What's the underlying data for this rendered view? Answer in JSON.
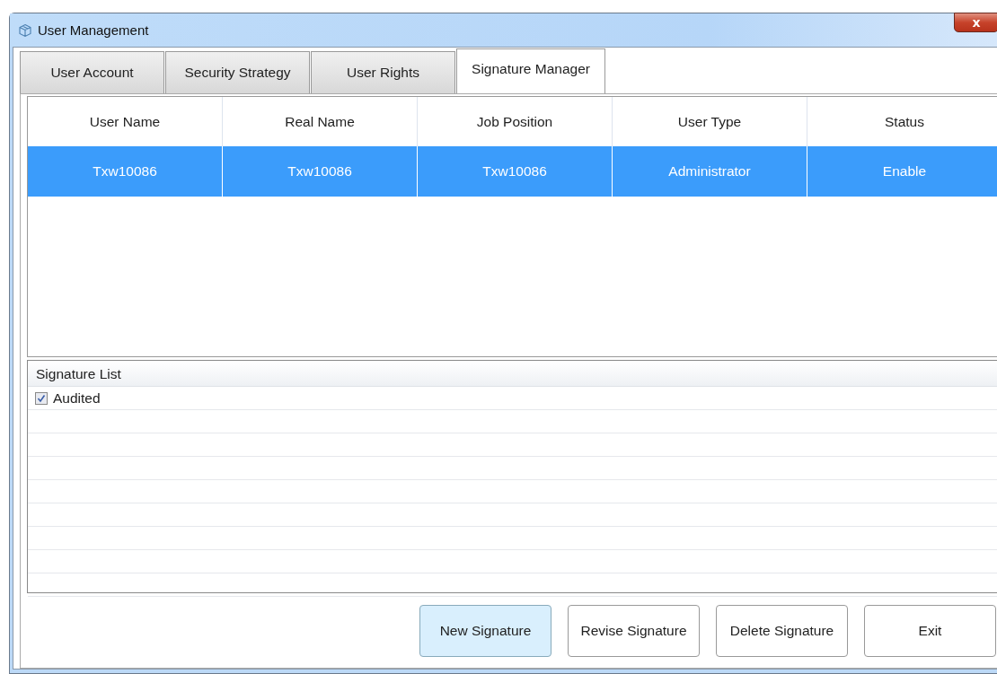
{
  "window": {
    "title": "User Management",
    "close": "x"
  },
  "tabs": [
    {
      "label": "User Account",
      "selected": false
    },
    {
      "label": "Security Strategy",
      "selected": false
    },
    {
      "label": "User Rights",
      "selected": false
    },
    {
      "label": "Signature Manager",
      "selected": true
    }
  ],
  "table": {
    "columns": [
      "User Name",
      "Real Name",
      "Job Position",
      "User Type",
      "Status"
    ],
    "rows": [
      {
        "cells": [
          "Txw10086",
          "Txw10086",
          "Txw10086",
          "Administrator",
          "Enable"
        ],
        "selected": true
      }
    ]
  },
  "signature_list": {
    "title": "Signature List",
    "items": [
      {
        "label": "Audited",
        "checked": true
      }
    ]
  },
  "buttons": [
    {
      "label": "New Signature",
      "highlighted": true
    },
    {
      "label": "Revise Signature",
      "highlighted": false
    },
    {
      "label": "Delete Signature",
      "highlighted": false
    },
    {
      "label": "Exit",
      "highlighted": false
    }
  ]
}
